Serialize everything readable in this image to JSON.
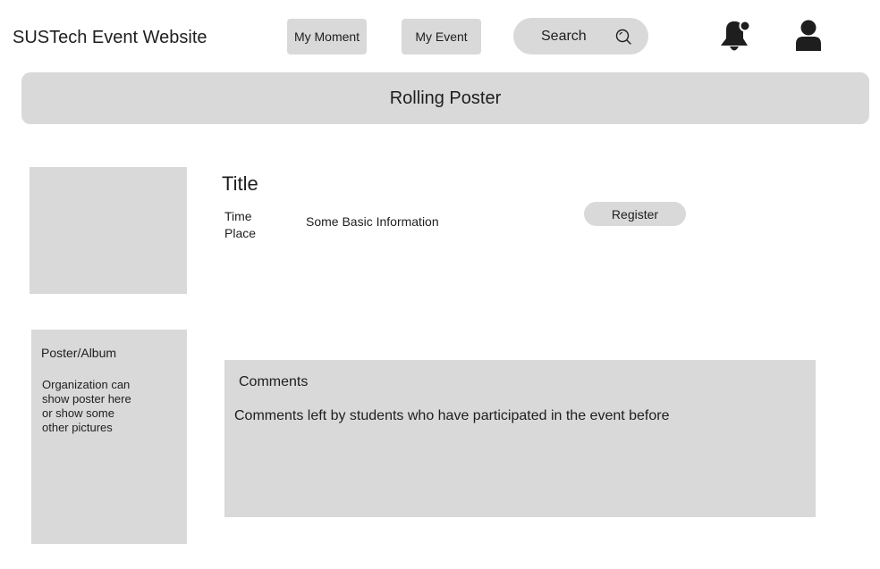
{
  "header": {
    "site_title": "SUSTech Event Website",
    "nav": {
      "my_moment": "My Moment",
      "my_event": "My Event"
    },
    "search": {
      "label": "Search",
      "icon": "search-icon"
    },
    "icons": {
      "notification": "bell-icon",
      "profile": "user-icon"
    }
  },
  "banner": {
    "label": "Rolling Poster"
  },
  "event": {
    "title": "Title",
    "time_label": "Time",
    "place_label": "Place",
    "basic_info": "Some Basic Information",
    "register_label": "Register"
  },
  "album": {
    "title": "Poster/Album",
    "description": "Organization can\nshow poster here\nor show some\nother pictures"
  },
  "comments": {
    "title": "Comments",
    "text": "Comments left by students who have participated in the event before"
  },
  "colors": {
    "placeholder_gray": "#d9d9d9",
    "text": "#1e1e1e"
  }
}
